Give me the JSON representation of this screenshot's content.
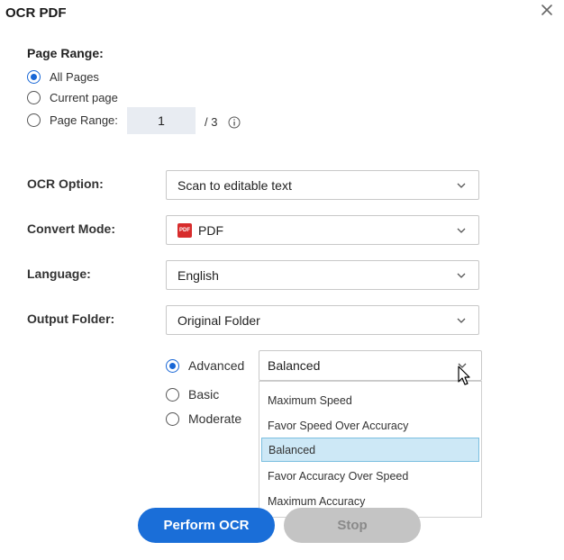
{
  "dialog": {
    "title": "OCR PDF"
  },
  "page_range": {
    "label": "Page Range:",
    "options": [
      "All Pages",
      "Current page",
      "Page Range:"
    ],
    "selected": "All Pages",
    "input_value": "1",
    "total": "/ 3"
  },
  "fields": {
    "ocr_option": {
      "label": "OCR Option:",
      "value": "Scan to editable text"
    },
    "convert_mode": {
      "label": "Convert Mode:",
      "value": "PDF",
      "badge": "PDF"
    },
    "language": {
      "label": "Language:",
      "value": "English"
    },
    "output_folder": {
      "label": "Output Folder:",
      "value": "Original Folder"
    }
  },
  "modes": {
    "options": [
      "Advanced",
      "Basic",
      "Moderate"
    ],
    "selected": "Advanced"
  },
  "accuracy": {
    "value": "Balanced",
    "options": [
      "Maximum Speed",
      "Favor Speed Over Accuracy",
      "Balanced",
      "Favor Accuracy Over Speed",
      "Maximum Accuracy"
    ],
    "highlighted": "Balanced"
  },
  "buttons": {
    "perform": "Perform OCR",
    "stop": "Stop"
  },
  "colors": {
    "accent": "#1a6ed8",
    "selection": "#cde8f6",
    "pdf_badge": "#d72c2c",
    "disabled": "#c4c4c4"
  },
  "icons": [
    "close-icon",
    "info-icon",
    "chevron-down-icon",
    "pdf-icon",
    "mouse-cursor-icon"
  ]
}
